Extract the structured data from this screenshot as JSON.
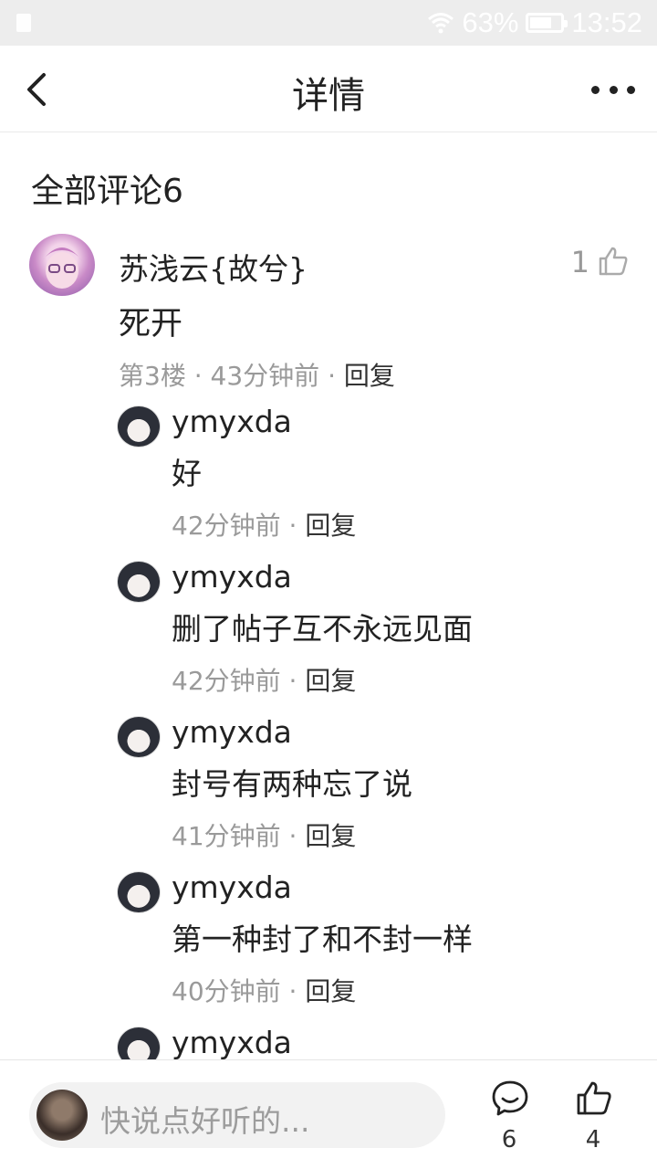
{
  "status_bar": {
    "battery_percent": "63%",
    "time": "13:52"
  },
  "nav": {
    "title": "详情"
  },
  "comments_header": "全部评论6",
  "main_comment": {
    "user": "苏浅云{故兮}",
    "text": "死开",
    "floor": "第3楼",
    "time": "43分钟前",
    "reply_label": "回复",
    "like_count": "1"
  },
  "replies": [
    {
      "user": "ymyxda",
      "text": "好",
      "time": "42分钟前",
      "reply_label": "回复"
    },
    {
      "user": "ymyxda",
      "text": "删了帖子互不永远见面",
      "time": "42分钟前",
      "reply_label": "回复"
    },
    {
      "user": "ymyxda",
      "text": "封号有两种忘了说",
      "time": "41分钟前",
      "reply_label": "回复"
    },
    {
      "user": "ymyxda",
      "text": "第一种封了和不封一样",
      "time": "40分钟前",
      "reply_label": "回复"
    },
    {
      "user": "ymyxda"
    }
  ],
  "bottom_bar": {
    "input_placeholder": "快说点好听的...",
    "comment_count": "6",
    "like_count": "4"
  },
  "icons": {
    "back": "chevron-left-icon",
    "more": "more-dots-icon",
    "like": "thumbs-up-icon",
    "comment": "chat-bubble-icon",
    "wifi": "wifi-icon",
    "battery": "battery-icon"
  }
}
